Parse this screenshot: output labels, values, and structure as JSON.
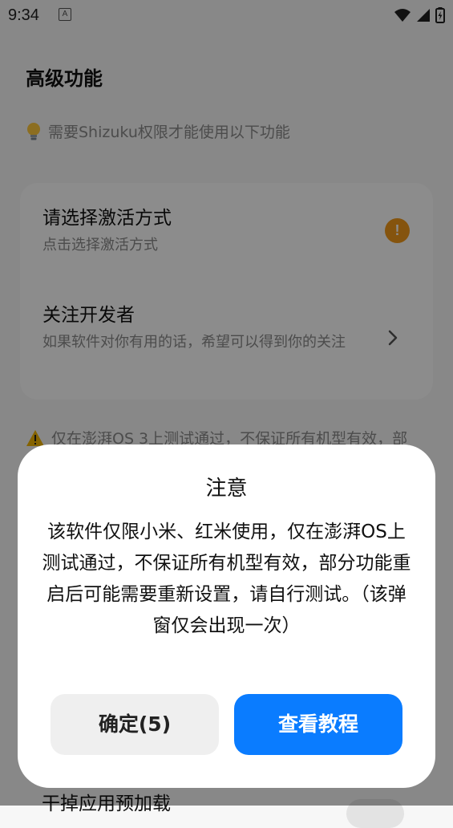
{
  "status_bar": {
    "time": "9:34",
    "notif_glyph": "A"
  },
  "page": {
    "title": "高级功能",
    "hint": "需要Shizuku权限才能使用以下功能",
    "hint_icon": "lightbulb-icon"
  },
  "card": {
    "items": [
      {
        "title": "请选择激活方式",
        "subtitle": "点击选择激活方式",
        "badge": "!"
      },
      {
        "title": "关注开发者",
        "subtitle": "如果软件对你有用的话，希望可以得到你的关注"
      }
    ]
  },
  "warning": {
    "text": "仅在澎湃OS 3上测试通过，不保证所有机型有效，部",
    "icon": "warning-icon"
  },
  "partial_item": {
    "title": "干掉应用预加载"
  },
  "dialog": {
    "title": "注意",
    "body": "该软件仅限小米、红米使用，仅在澎湃OS上测试通过，不保证所有机型有效，部分功能重启后可能需要重新设置，请自行测试。（该弹窗仅会出现一次）",
    "confirm_label": "确定(5)",
    "tutorial_label": "查看教程"
  },
  "colors": {
    "accent": "#0a7cff",
    "warning_badge": "#f29a1b",
    "secondary_text": "#8a8a8a",
    "overlay": "rgba(0,0,0,0.45)"
  }
}
